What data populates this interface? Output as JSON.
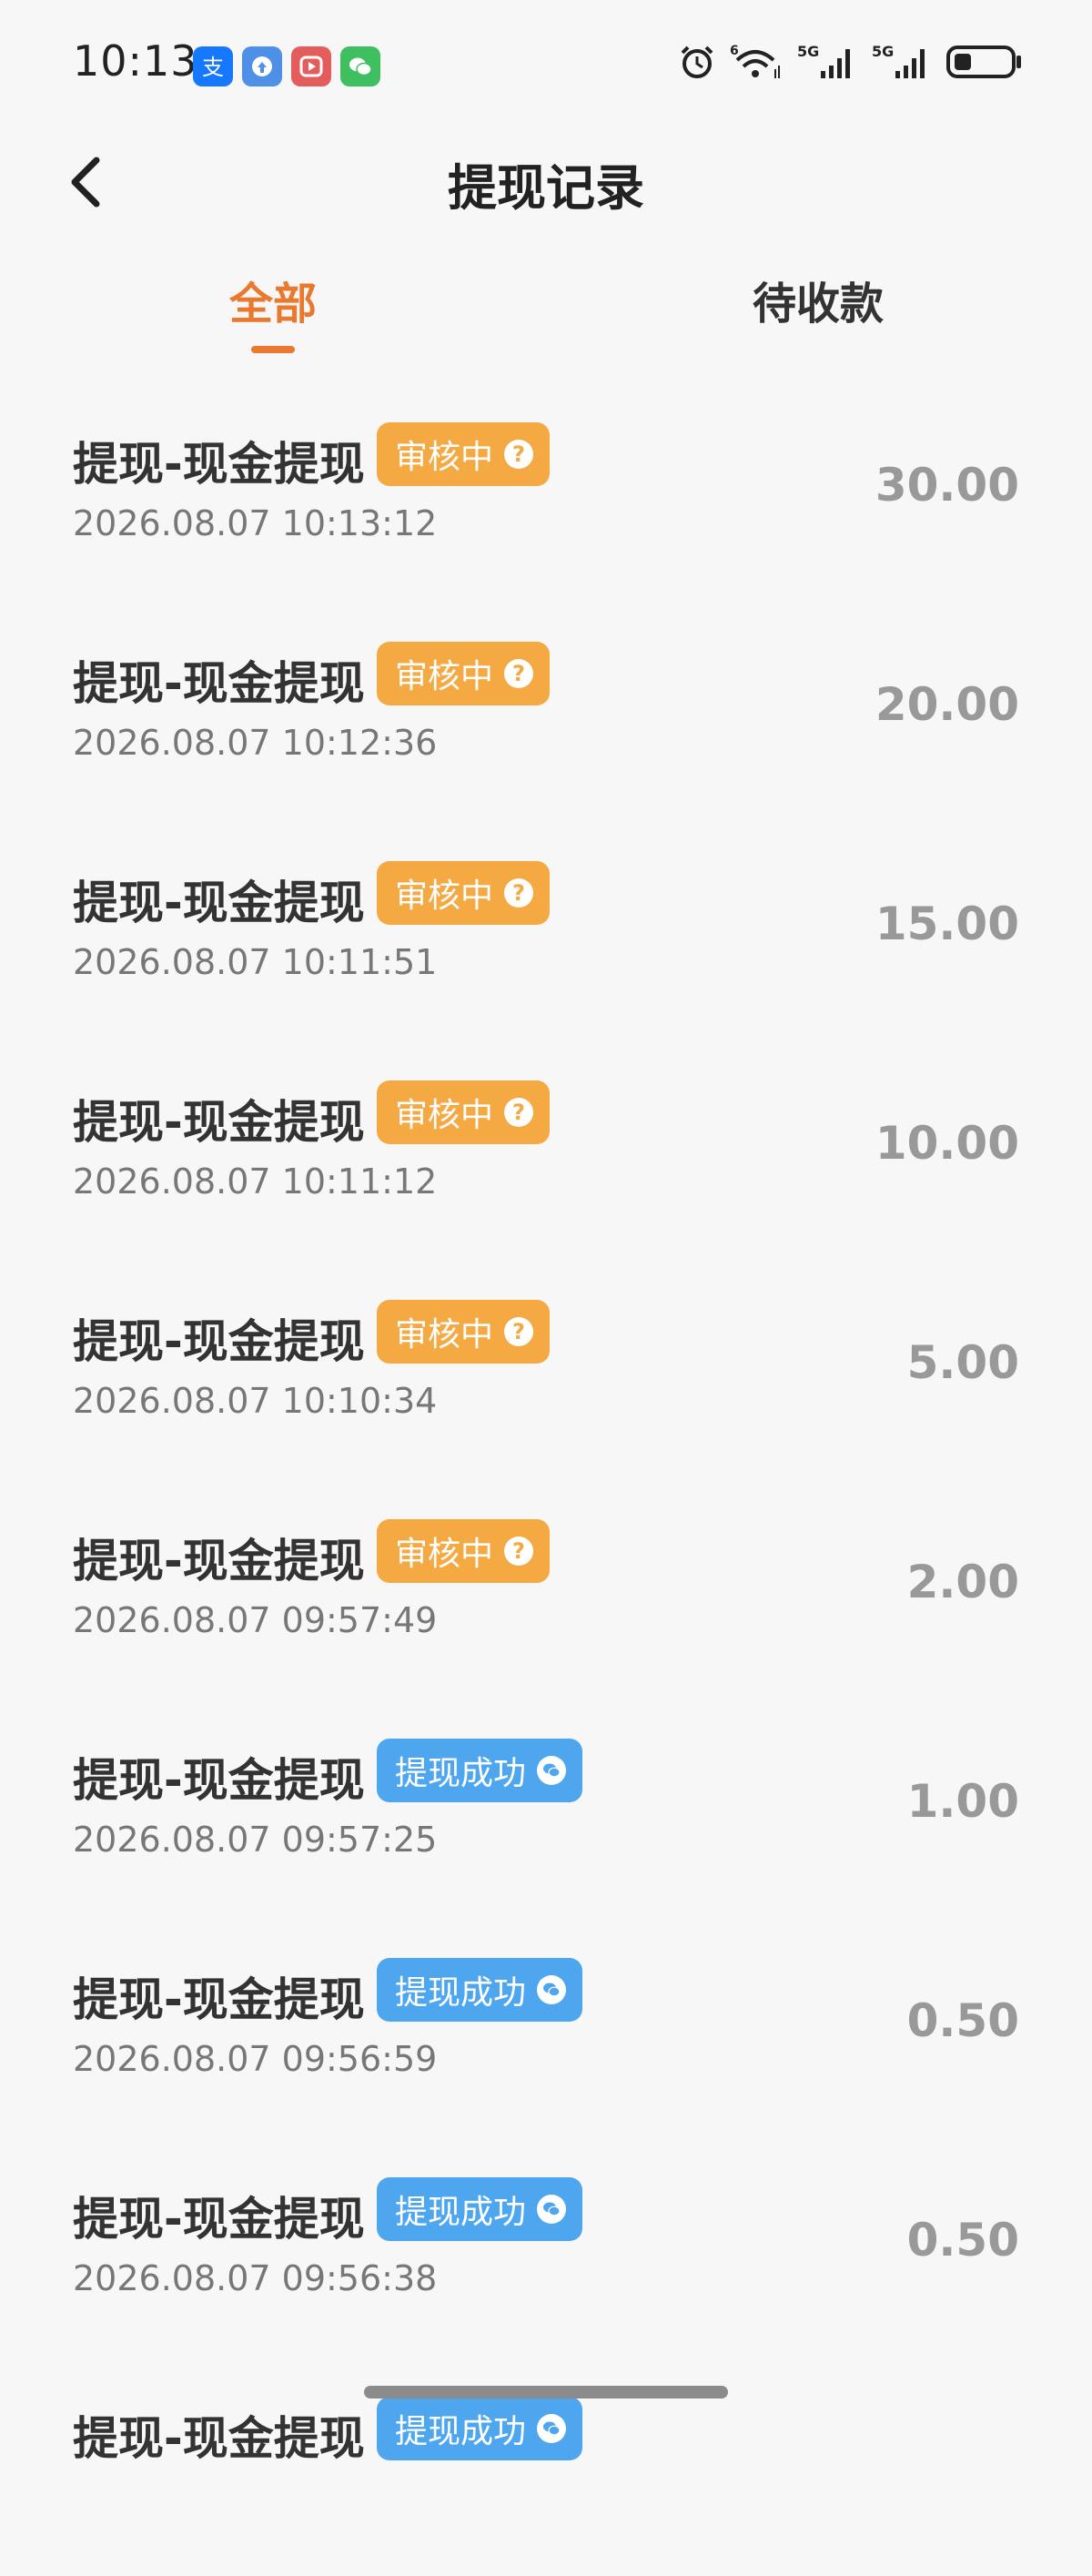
{
  "status_bar": {
    "time": "10:13",
    "app_icons": [
      {
        "name": "alipay-icon",
        "color": "#1677ff"
      },
      {
        "name": "sync-app-icon",
        "color": "#4e8fe8"
      },
      {
        "name": "video-play-icon",
        "color": "#e35d5d"
      },
      {
        "name": "wechat-icon",
        "color": "#3fbf5f"
      }
    ],
    "network_1": "5G",
    "network_2": "5G",
    "wifi_label": "6"
  },
  "header": {
    "title": "提现记录",
    "back_icon": "chevron-left-icon"
  },
  "tabs": [
    {
      "label": "全部",
      "active": true
    },
    {
      "label": "待收款",
      "active": false
    }
  ],
  "colors": {
    "accent": "#e8792f",
    "review_badge": "#f4a943",
    "success_badge": "#4ea6ef"
  },
  "records": [
    {
      "title": "提现-现金提现",
      "status": "审核中",
      "status_type": "review",
      "status_icon": "?",
      "time": "2026.08.07 10:13:12",
      "amount": "30.00"
    },
    {
      "title": "提现-现金提现",
      "status": "审核中",
      "status_type": "review",
      "status_icon": "?",
      "time": "2026.08.07 10:12:36",
      "amount": "20.00"
    },
    {
      "title": "提现-现金提现",
      "status": "审核中",
      "status_type": "review",
      "status_icon": "?",
      "time": "2026.08.07 10:11:51",
      "amount": "15.00"
    },
    {
      "title": "提现-现金提现",
      "status": "审核中",
      "status_type": "review",
      "status_icon": "?",
      "time": "2026.08.07 10:11:12",
      "amount": "10.00"
    },
    {
      "title": "提现-现金提现",
      "status": "审核中",
      "status_type": "review",
      "status_icon": "?",
      "time": "2026.08.07 10:10:34",
      "amount": "5.00"
    },
    {
      "title": "提现-现金提现",
      "status": "审核中",
      "status_type": "review",
      "status_icon": "?",
      "time": "2026.08.07 09:57:49",
      "amount": "2.00"
    },
    {
      "title": "提现-现金提现",
      "status": "提现成功",
      "status_type": "success",
      "status_icon": "wechat",
      "time": "2026.08.07 09:57:25",
      "amount": "1.00"
    },
    {
      "title": "提现-现金提现",
      "status": "提现成功",
      "status_type": "success",
      "status_icon": "wechat",
      "time": "2026.08.07 09:56:59",
      "amount": "0.50"
    },
    {
      "title": "提现-现金提现",
      "status": "提现成功",
      "status_type": "success",
      "status_icon": "wechat",
      "time": "2026.08.07 09:56:38",
      "amount": "0.50"
    },
    {
      "title": "提现-现金提现",
      "status": "提现成功",
      "status_type": "success",
      "status_icon": "wechat",
      "time": "",
      "amount": ""
    }
  ]
}
